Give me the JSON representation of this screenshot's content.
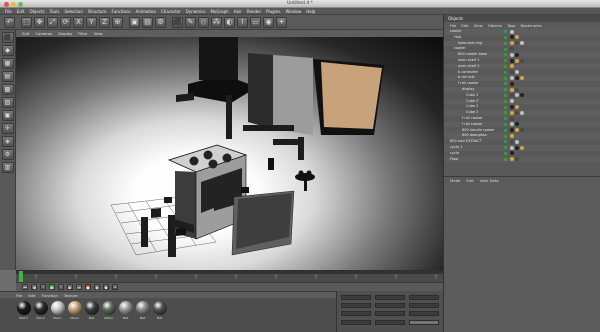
{
  "window": {
    "title": "Untitled 4 *"
  },
  "menubar": [
    "File",
    "Edit",
    "Objects",
    "Tools",
    "Selection",
    "Structure",
    "Functions",
    "Animation",
    "Character",
    "Dynamics",
    "MoGraph",
    "Hair",
    "Render",
    "Plugins",
    "Window",
    "Help"
  ],
  "toolbar": {
    "icons": [
      "undo-icon",
      "live-select-icon",
      "move-icon",
      "scale-icon",
      "rotate-icon",
      "axis-x-icon",
      "axis-y-icon",
      "axis-z-icon",
      "coordinate-system-icon",
      "render-view-icon",
      "render-picture-viewer-icon",
      "render-settings-icon",
      "cube-icon",
      "pen-icon",
      "subdivision-icon",
      "array-icon",
      "boole-icon",
      "deformer-icon",
      "floor-icon",
      "camera-icon",
      "light-icon"
    ]
  },
  "viewport": {
    "menu": [
      "Edit",
      "Cameras",
      "Display",
      "Filter",
      "View"
    ]
  },
  "object_manager": {
    "header": "Objects",
    "menu": [
      "File",
      "Edit",
      "View",
      "Objects",
      "Tags",
      "Bookmarks"
    ],
    "rows": [
      {
        "label": "cooker",
        "indent": 1
      },
      {
        "label": "Hob",
        "indent": 2
      },
      {
        "label": "hobs and ring",
        "indent": 3
      },
      {
        "label": "cooker",
        "indent": 2
      },
      {
        "label": "600 cooker base",
        "indent": 3
      },
      {
        "label": "oven shelf 1",
        "indent": 3
      },
      {
        "label": "oven shelf 2",
        "indent": 3
      },
      {
        "label": "b controller",
        "indent": 3
      },
      {
        "label": "b rail unit",
        "indent": 3
      },
      {
        "label": "f rail cooker",
        "indent": 3
      },
      {
        "label": "display",
        "indent": 4
      },
      {
        "label": "Cube 2",
        "indent": 5
      },
      {
        "label": "Cube 2",
        "indent": 5
      },
      {
        "label": "Cube 2",
        "indent": 5
      },
      {
        "label": "Cube 2",
        "indent": 5
      },
      {
        "label": "f rail cooker",
        "indent": 4
      },
      {
        "label": "f rail cooker",
        "indent": 4
      },
      {
        "label": "600 handle cooker",
        "indent": 4
      },
      {
        "label": "600 doorglass",
        "indent": 4
      },
      {
        "label": "600 wall EXTRACT",
        "indent": 1
      },
      {
        "label": "cycle 1",
        "indent": 1
      },
      {
        "label": "cycle",
        "indent": 1
      },
      {
        "label": "Floor",
        "indent": 1
      }
    ]
  },
  "attribute_manager": {
    "menu": [
      "Mode",
      "Edit",
      "User Data"
    ]
  },
  "material_manager": {
    "menu": [
      "File",
      "Edit",
      "Function",
      "Texture"
    ],
    "materials": [
      {
        "name": "Mat.3",
        "color": "#1b1b1b"
      },
      {
        "name": "Mat.2",
        "color": "#2a2a2a"
      },
      {
        "name": "Mat.1",
        "color": "#c9c9c9"
      },
      {
        "name": "Wood",
        "color": "#c8a27a"
      },
      {
        "name": "Mat",
        "color": "#3b3b3b"
      },
      {
        "name": "Metal",
        "color": "#5d6c5d"
      },
      {
        "name": "Mat",
        "color": "#9a9a9a"
      },
      {
        "name": "Mat",
        "color": "#8a8a8a"
      },
      {
        "name": "Mat",
        "color": "#505050"
      }
    ]
  },
  "transport": {
    "icons": [
      "go-start-icon",
      "prev-key-icon",
      "prev-frame-icon",
      "play-icon",
      "next-frame-icon",
      "next-key-icon",
      "go-end-icon",
      "record-icon",
      "autokey-icon",
      "keyframe-icon",
      "motion-icon"
    ]
  },
  "colors": {
    "accent_green": "#39b54a",
    "accent_red": "#d23c2c",
    "wood": "#c8a27a"
  }
}
